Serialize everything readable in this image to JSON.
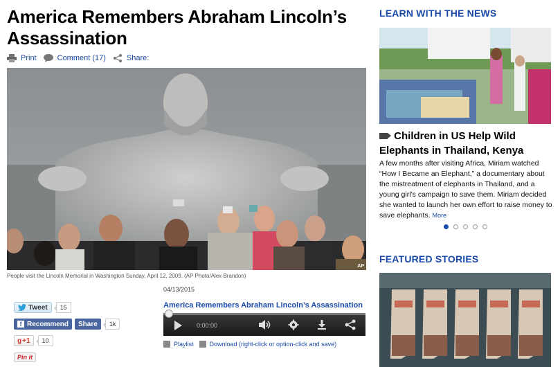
{
  "article": {
    "title": "America Remembers Abraham Lincoln’s Assassination",
    "actions": {
      "print": "Print",
      "comment": "Comment (17)",
      "share": "Share:"
    },
    "photo_caption": "People visit the Lincoln Memorial in Washington Sunday, April 12, 2009. (AP Photo/Alex Brandon)",
    "photo_credit": "AP",
    "date": "04/13/2015"
  },
  "social": {
    "tweet_label": "Tweet",
    "tweet_count": "15",
    "recommend_label": "Recommend",
    "share_label": "Share",
    "fb_count": "1k",
    "gplus_label": "+1",
    "gplus_count": "10",
    "pin_label": "Pin it"
  },
  "player": {
    "title": "America Remembers Abraham Lincoln’s Assassination",
    "time": "0:00:00",
    "playlist_label": "Playlist",
    "download_label": "Download (right-click or option-click and save)"
  },
  "sidebar": {
    "learn_heading": "LEARN WITH THE NEWS",
    "story_title": "Children in US Help Wild Elephants in Thailand, Kenya",
    "story_body": "A few months after visiting Africa, Miriam watched “How I Became an Elephant,” a documentary about the mistreatment of elephants in Thailand, and a young girl’s campaign to save them. Miriam decided she wanted to launch her own effort to raise money to save elephants.",
    "more_label": "More",
    "carousel_active": 1,
    "carousel_total": 5,
    "featured_heading": "FEATURED STORIES"
  },
  "colors": {
    "link_blue": "#1a4aa8",
    "facebook_blue": "#4a66a0",
    "player_bg": "#2a2a2a"
  }
}
